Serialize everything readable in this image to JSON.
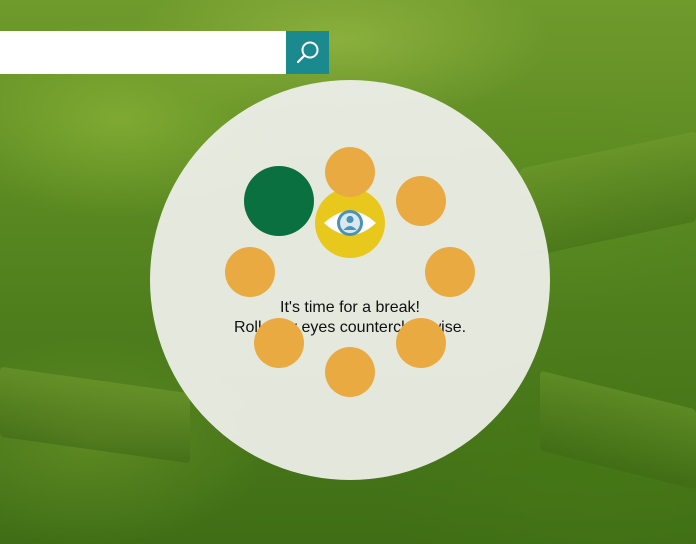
{
  "search": {
    "value": "",
    "placeholder": "",
    "button_icon": "search-icon"
  },
  "break_reminder": {
    "title": "It's time for a break!",
    "instruction": "Roll your eyes counterclockwise.",
    "center_icon": "eye-icon",
    "dot_count": 8,
    "active_dot_index": 7,
    "colors": {
      "inactive_dot": "#eaaa42",
      "active_dot": "#0b7040",
      "eye_badge": "#e8c81c",
      "iris": "#4b93b5"
    }
  },
  "accent_color": "#1a8a8f"
}
